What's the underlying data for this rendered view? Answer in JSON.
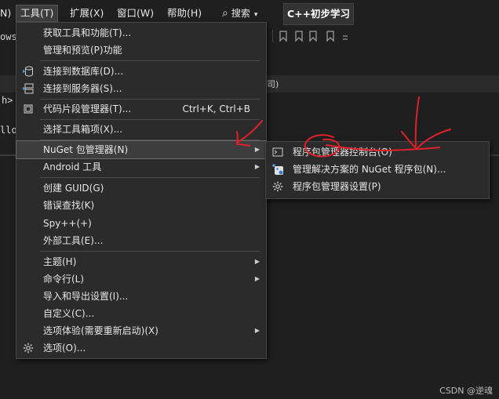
{
  "menubar": {
    "left_fragment": "N)",
    "items": [
      "工具(T)",
      "扩展(X)",
      "窗口(W)",
      "帮助(H)"
    ],
    "search_label": "搜索",
    "brand_button": "C++初步学习"
  },
  "background": {
    "toolbar_fragment": "ows",
    "code_line_1": "h>",
    "code_line_2": "llo",
    "tab_fragment": "司)"
  },
  "tools_menu": {
    "get_tools": "获取工具和功能(T)...",
    "manage_preview": "管理和预览(P)功能",
    "connect_db": "连接到数据库(D)...",
    "connect_server": "连接到服务器(S)...",
    "snippet_manager": "代码片段管理器(T)...",
    "snippet_shortcut": "Ctrl+K, Ctrl+B",
    "choose_toolbox": "选择工具箱项(X)...",
    "nuget": "NuGet 包管理器(N)",
    "android": "Android 工具",
    "create_guid": "创建 GUID(G)",
    "error_lookup": "错误查找(K)",
    "spy": "Spy++(+)",
    "external_tools": "外部工具(E)...",
    "theme": "主题(H)",
    "command_line": "命令行(L)",
    "import_export": "导入和导出设置(I)...",
    "customize": "自定义(C)...",
    "preview_features": "选项体验(需要重新启动)(X)",
    "options": "选项(O)..."
  },
  "nuget_submenu": {
    "console": "程序包管理器控制台(O)",
    "manage_solution": "管理解决方案的 NuGet 程序包(N)...",
    "settings": "程序包管理器设置(P)"
  },
  "colors": {
    "annotation": "#e0202a",
    "menu_background": "#2b2b2b",
    "highlight": "#3d3d3d"
  },
  "watermark": "CSDN @逆魂"
}
